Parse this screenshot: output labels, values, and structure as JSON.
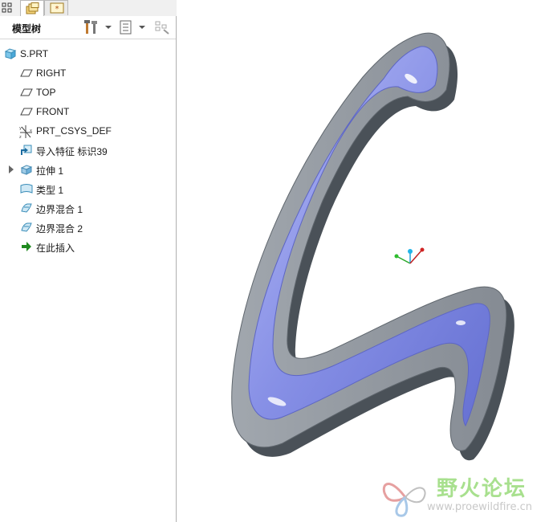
{
  "panel": {
    "title": "模型树",
    "icons": [
      "model-tree-tab-icon",
      "layers-tab-icon",
      "favorites-tab-icon",
      "settings-icon",
      "show-icon",
      "filter-icon"
    ]
  },
  "tree": {
    "items": [
      {
        "label": "S.PRT",
        "icon": "part-icon"
      },
      {
        "label": "RIGHT",
        "icon": "datum-plane-icon"
      },
      {
        "label": "TOP",
        "icon": "datum-plane-icon"
      },
      {
        "label": "FRONT",
        "icon": "datum-plane-icon"
      },
      {
        "label": "PRT_CSYS_DEF",
        "icon": "coordinate-system-icon"
      },
      {
        "label": "导入特征 标识39",
        "icon": "import-feature-icon"
      },
      {
        "label": "拉伸 1",
        "icon": "extrude-icon"
      },
      {
        "label": "类型 1",
        "icon": "style-feature-icon"
      },
      {
        "label": "边界混合 1",
        "icon": "boundary-blend-icon"
      },
      {
        "label": "边界混合 2",
        "icon": "boundary-blend-icon"
      },
      {
        "label": "在此插入",
        "icon": "insert-here-arrow-icon"
      }
    ]
  },
  "watermark": {
    "title": "野火论坛",
    "url": "www.proewildfire.cn"
  },
  "colors": {
    "shell_face": "#8d949c",
    "shell_side": "#4e555c",
    "inner_surface": "#8a93e8",
    "panel_border": "#b0b0b0"
  }
}
